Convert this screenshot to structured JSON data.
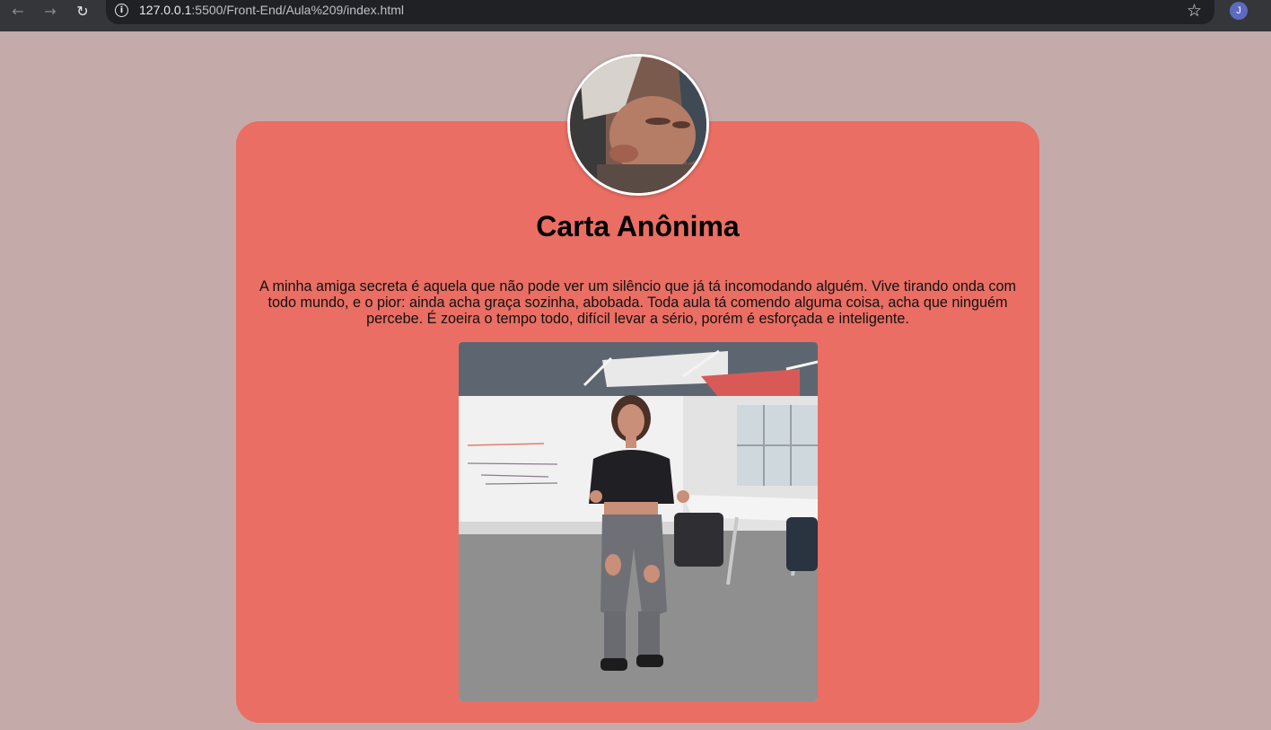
{
  "browser": {
    "back_icon": "←",
    "forward_icon": "→",
    "reload_icon": "↻",
    "info_icon": "i",
    "url_host": "127.0.0.1",
    "url_rest": ":5500/Front-End/Aula%209/index.html",
    "bookmark_icon": "☆",
    "profile_initial": "J",
    "profile_color": "#5c6bc0"
  },
  "page": {
    "background": "#c5aaaa",
    "card_color": "#ea6e63",
    "title": "Carta Anônima",
    "letter": "A minha amiga secreta é aquela que não pode ver um silêncio que já tá incomodando alguém. Vive tirando onda com todo mundo, e o pior: ainda acha graça sozinha, abobada. Toda aula tá comendo alguma coisa, acha que ninguém percebe. É zoeira o tempo todo, difícil levar a sério, porém é esforçada e inteligente."
  }
}
